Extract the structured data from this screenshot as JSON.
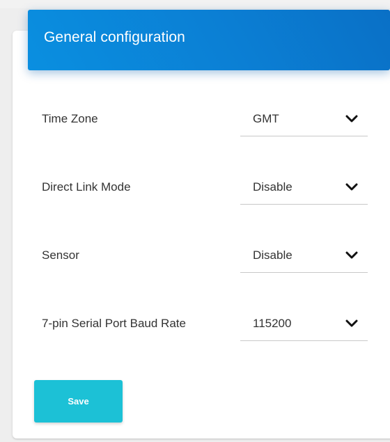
{
  "card": {
    "title": "General configuration"
  },
  "fields": [
    {
      "label": "Time Zone",
      "value": "GMT"
    },
    {
      "label": "Direct Link Mode",
      "value": "Disable"
    },
    {
      "label": "Sensor",
      "value": "Disable"
    },
    {
      "label": "7-pin Serial Port Baud Rate",
      "value": "115200"
    }
  ],
  "actions": {
    "save_label": "Save"
  },
  "theme": {
    "header_gradient_start": "#0a8fe0",
    "header_gradient_end": "#0a70c6",
    "save_button_color": "#1cc1d6",
    "text_color": "#333333"
  },
  "icons": {
    "dropdown": "chevron-down-icon"
  }
}
